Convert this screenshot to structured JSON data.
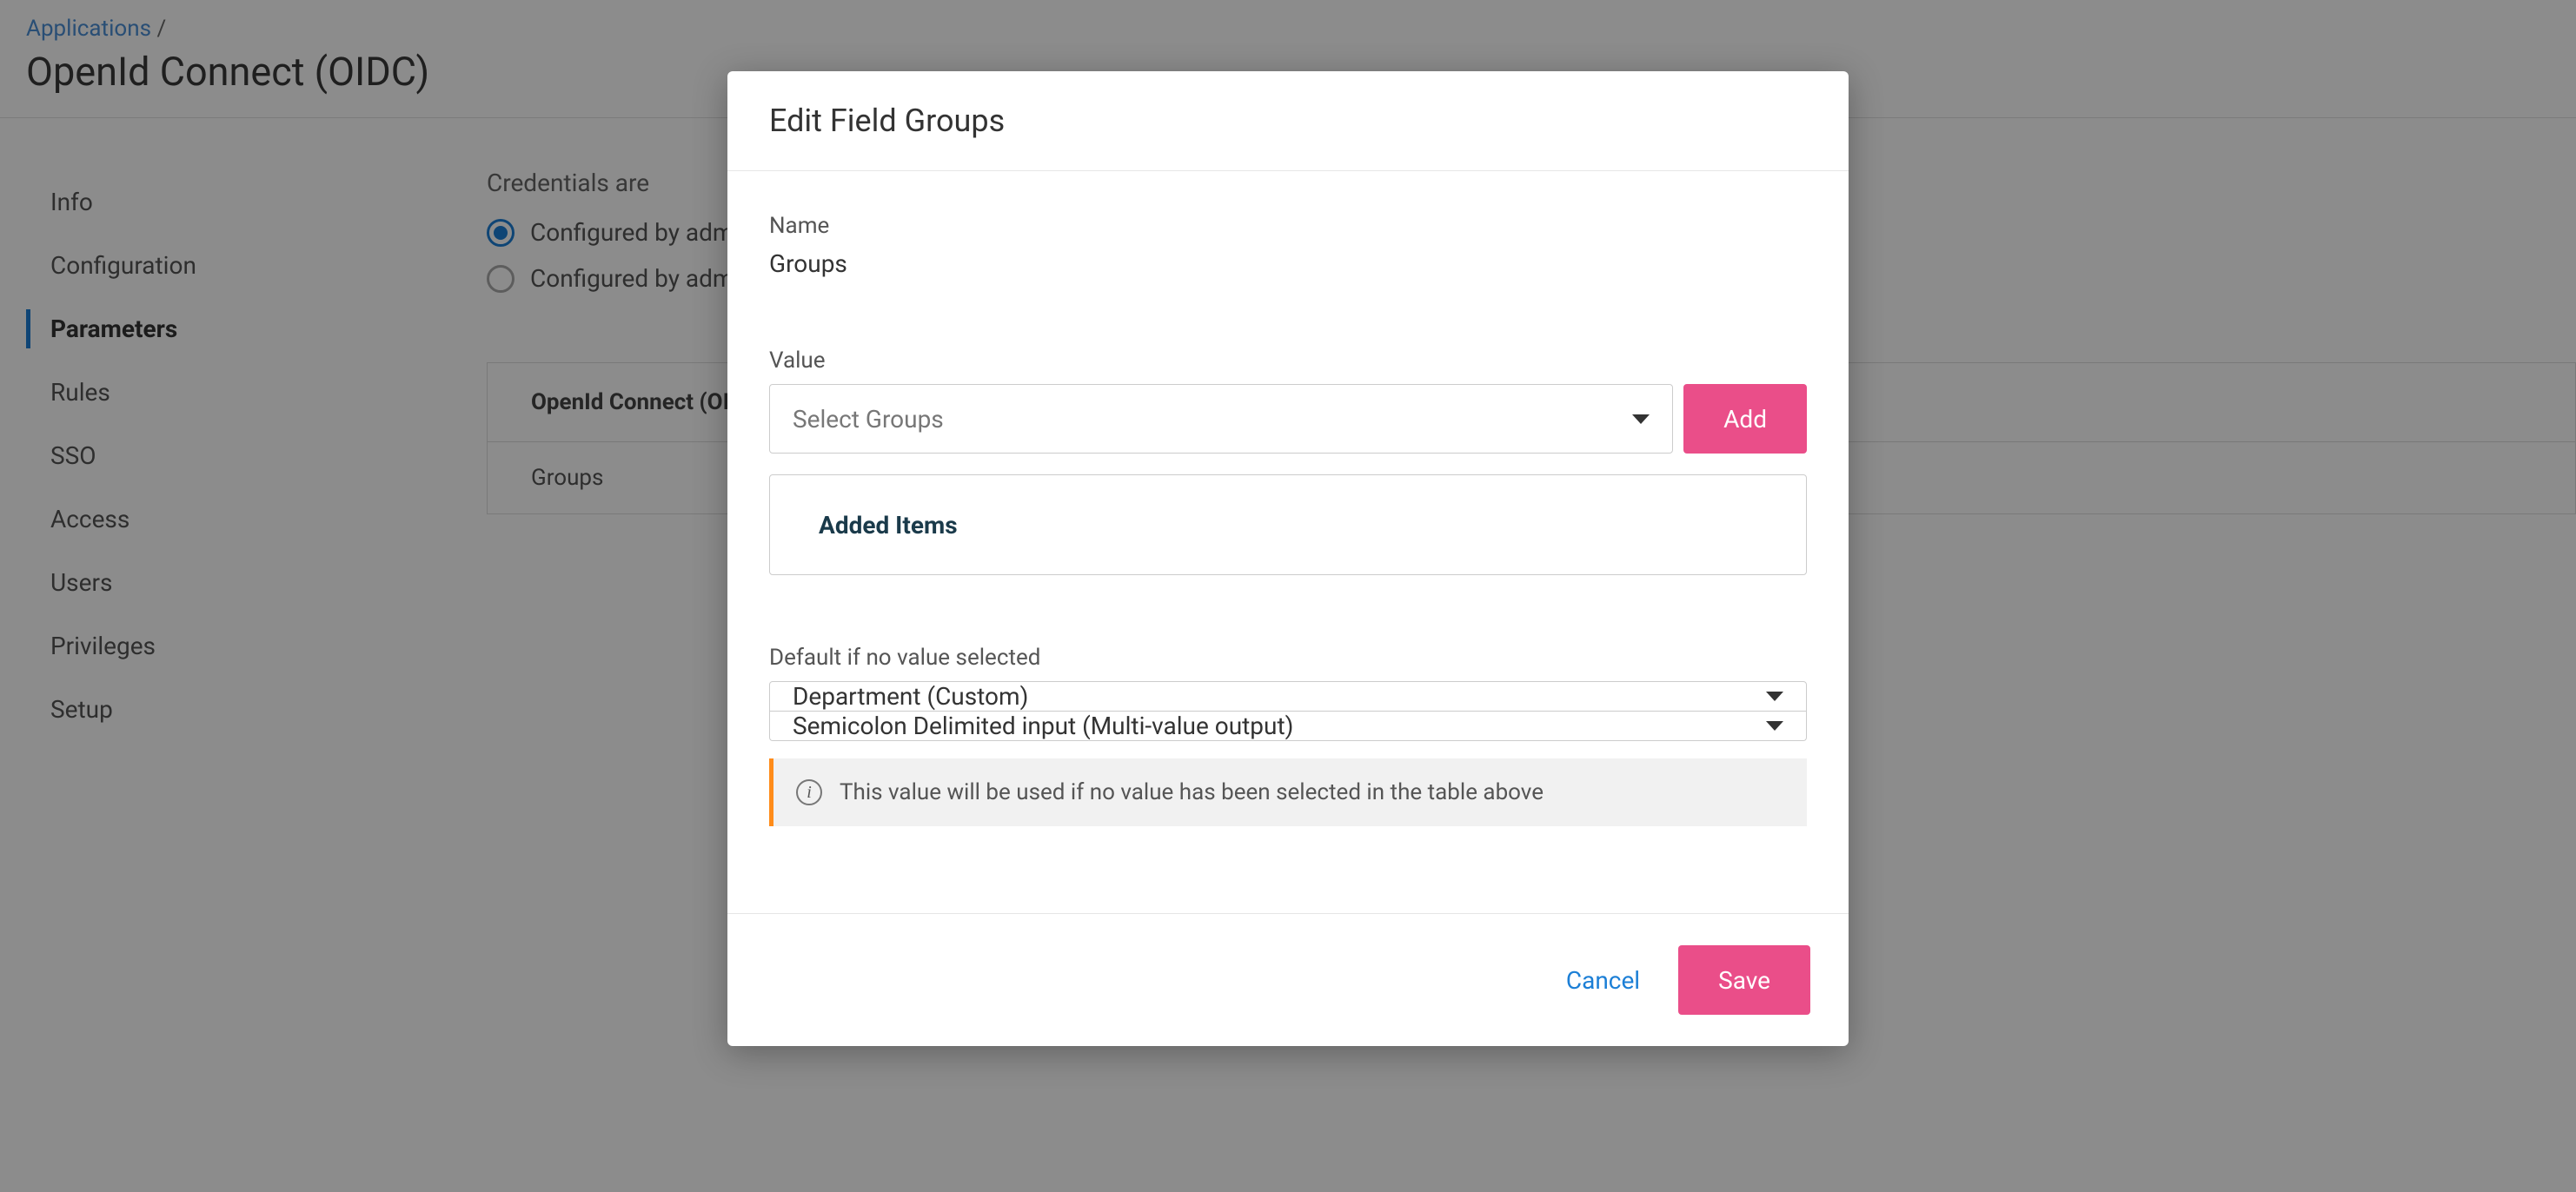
{
  "breadcrumb": {
    "parent": "Applications",
    "separator": "/"
  },
  "page_title": "OpenId Connect (OIDC)",
  "sidebar": {
    "items": [
      {
        "label": "Info"
      },
      {
        "label": "Configuration"
      },
      {
        "label": "Parameters"
      },
      {
        "label": "Rules"
      },
      {
        "label": "SSO"
      },
      {
        "label": "Access"
      },
      {
        "label": "Users"
      },
      {
        "label": "Privileges"
      },
      {
        "label": "Setup"
      }
    ],
    "active_index": 2
  },
  "main": {
    "credentials_label": "Credentials are",
    "credentials_options": [
      {
        "label": "Configured by admin",
        "checked": true
      },
      {
        "label": "Configured by admins and shared by all users",
        "checked": false
      }
    ],
    "table_header": "OpenId Connect (OIDC) Field",
    "table_rows": [
      {
        "label": "Groups"
      }
    ]
  },
  "modal": {
    "title": "Edit Field Groups",
    "name_label": "Name",
    "name_value": "Groups",
    "value_label": "Value",
    "value_select_placeholder": "Select Groups",
    "add_button": "Add",
    "added_items_label": "Added Items",
    "default_label": "Default if no value selected",
    "default_select_1": "Department (Custom)",
    "default_select_2": "Semicolon Delimited input (Multi-value output)",
    "info_text": "This value will be used if no value has been selected in the table above",
    "cancel_button": "Cancel",
    "save_button": "Save"
  }
}
